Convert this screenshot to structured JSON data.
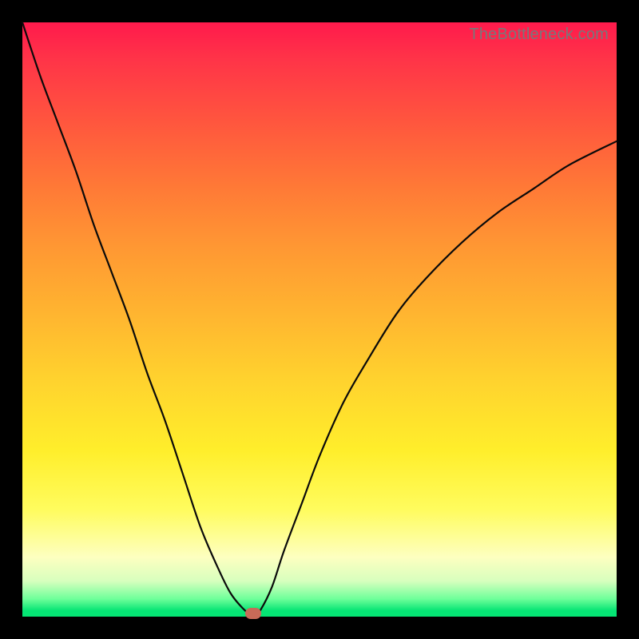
{
  "attribution": "TheBottleneck.com",
  "colors": {
    "page_bg": "#000000",
    "curve": "#0a0a0a",
    "marker": "#c86a58",
    "gradient_stops": [
      "#ff1a4c",
      "#ff3348",
      "#ff5a3d",
      "#ff7a36",
      "#ff9833",
      "#ffb230",
      "#ffd22e",
      "#ffee2b",
      "#fffc5e",
      "#fdffc0",
      "#d8ffbe",
      "#6fff9a",
      "#05e574"
    ]
  },
  "chart_data": {
    "type": "line",
    "title": "",
    "xlabel": "",
    "ylabel": "",
    "xlim": [
      0,
      100
    ],
    "ylim": [
      0,
      100
    ],
    "series": [
      {
        "name": "curve",
        "x": [
          0,
          3,
          6,
          9,
          12,
          15,
          18,
          21,
          24,
          27,
          30,
          33,
          35,
          37,
          38.9,
          40,
          42,
          44,
          47,
          50,
          54,
          58,
          63,
          68,
          74,
          80,
          86,
          92,
          100
        ],
        "y": [
          100,
          91,
          83,
          75,
          66,
          58,
          50,
          41,
          33,
          24,
          15,
          8,
          4,
          1.5,
          0,
          1,
          5,
          11,
          19,
          27,
          36,
          43,
          51,
          57,
          63,
          68,
          72,
          76,
          80
        ]
      }
    ],
    "marker": {
      "x": 38.9,
      "y": 0.5
    },
    "grid": false,
    "legend": false
  }
}
